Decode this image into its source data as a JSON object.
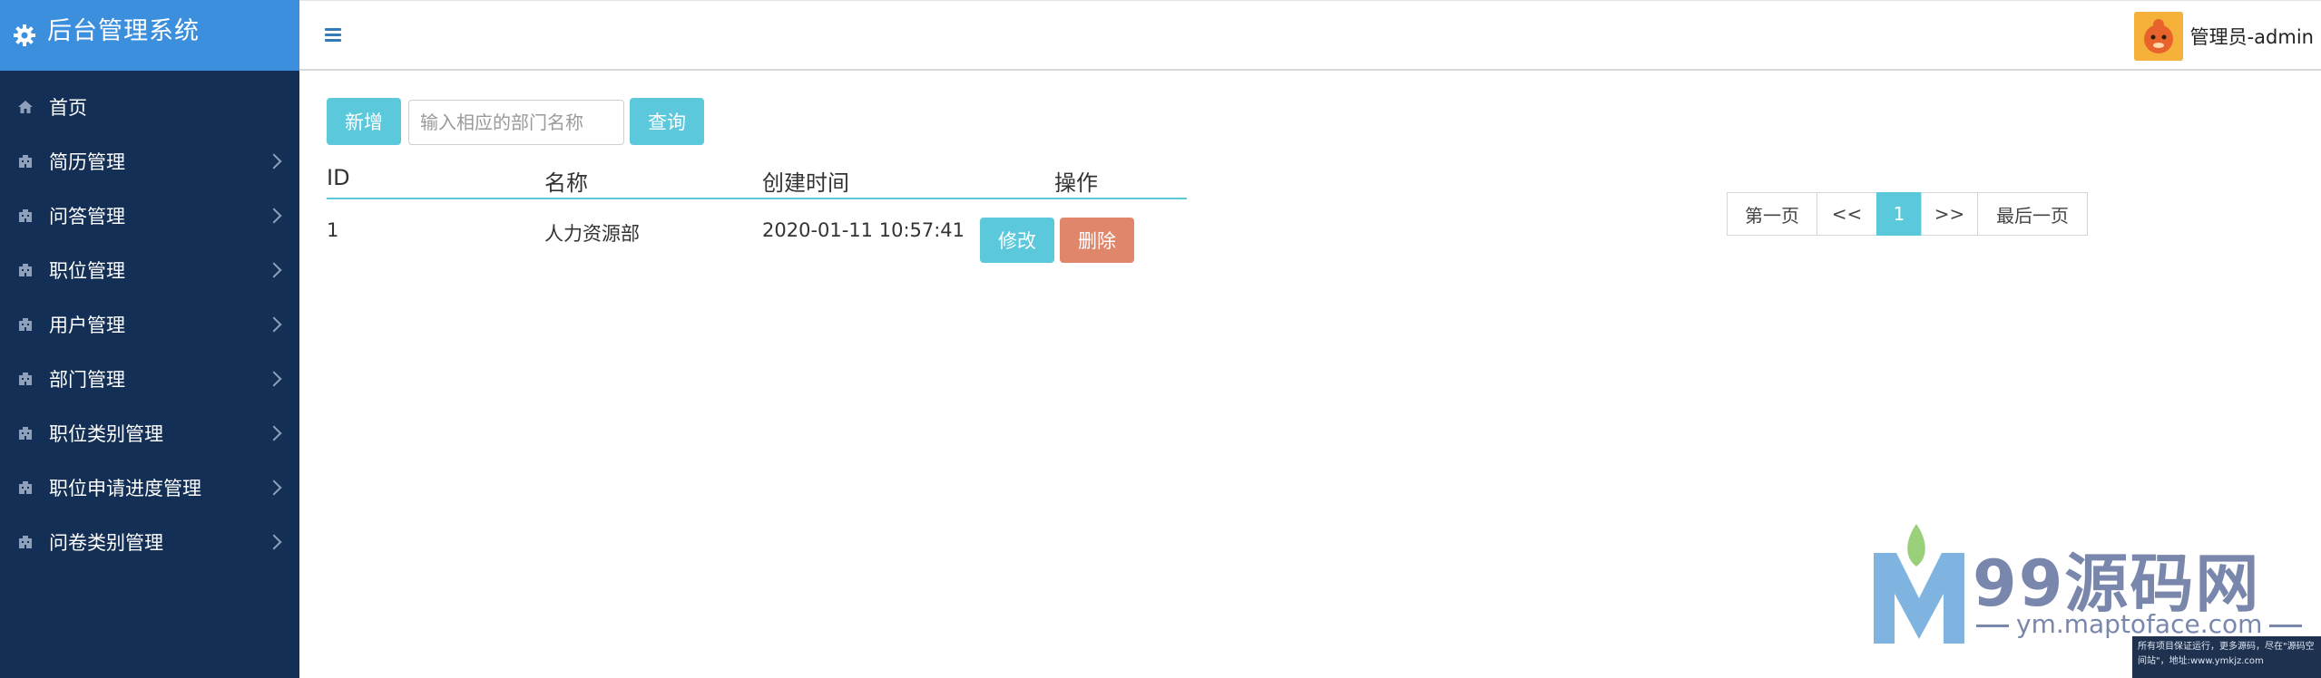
{
  "sidebar": {
    "title": "后台管理系统",
    "items": [
      {
        "label": "首页",
        "icon": "home-icon",
        "has_children": false
      },
      {
        "label": "简历管理",
        "icon": "building-icon",
        "has_children": true
      },
      {
        "label": "问答管理",
        "icon": "building-icon",
        "has_children": true
      },
      {
        "label": "职位管理",
        "icon": "building-icon",
        "has_children": true
      },
      {
        "label": "用户管理",
        "icon": "building-icon",
        "has_children": true
      },
      {
        "label": "部门管理",
        "icon": "building-icon",
        "has_children": true
      },
      {
        "label": "职位类别管理",
        "icon": "building-icon",
        "has_children": true
      },
      {
        "label": "职位申请进度管理",
        "icon": "building-icon",
        "has_children": true
      },
      {
        "label": "问卷类别管理",
        "icon": "building-icon",
        "has_children": true
      }
    ]
  },
  "header": {
    "user_name": "管理员-admin"
  },
  "toolbar": {
    "add_label": "新增",
    "search_placeholder": "输入相应的部门名称",
    "search_value": "",
    "query_label": "查询"
  },
  "table": {
    "columns": [
      "ID",
      "名称",
      "创建时间",
      "操作"
    ],
    "rows": [
      {
        "id": "1",
        "name": "人力资源部",
        "created": "2020-01-11 10:57:41",
        "edit_label": "修改",
        "delete_label": "删除"
      }
    ]
  },
  "pagination": {
    "first": "第一页",
    "prev": "<<",
    "current": "1",
    "next": ">>",
    "last": "最后一页"
  },
  "watermark": {
    "brand": "99源码网",
    "url": "ym.maptoface.com",
    "note": "所有项目保证运行，更多源码，尽在\"源码空间站\"，地址:www.ymkjz.com"
  },
  "colors": {
    "sidebar_bg": "#142f55",
    "sidebar_header": "#3b8fdc",
    "info": "#5bc8dc",
    "danger": "#e0866b"
  }
}
